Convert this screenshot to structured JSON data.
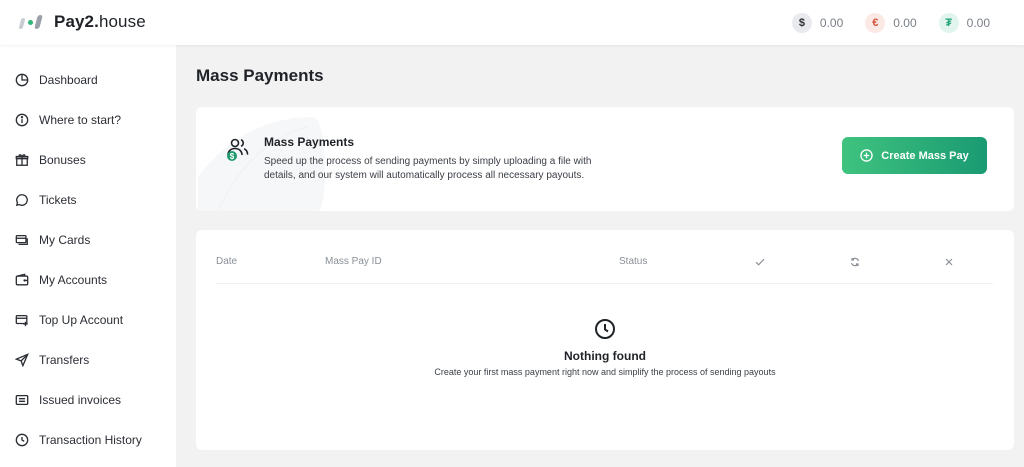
{
  "brand": {
    "name_bold": "Pay2.",
    "name_light": "house"
  },
  "balances": [
    {
      "currency_icon": "dollar-icon",
      "symbol": "$",
      "amount": "0.00"
    },
    {
      "currency_icon": "euro-icon",
      "symbol": "€",
      "amount": "0.00"
    },
    {
      "currency_icon": "tether-icon",
      "symbol": "₮",
      "amount": "0.00"
    }
  ],
  "sidebar": {
    "items": [
      {
        "label": "Dashboard",
        "icon": "pie-chart-icon"
      },
      {
        "label": "Where to start?",
        "icon": "info-icon"
      },
      {
        "label": "Bonuses",
        "icon": "gift-icon"
      },
      {
        "label": "Tickets",
        "icon": "chat-bubble-icon"
      },
      {
        "label": "My Cards",
        "icon": "cards-icon"
      },
      {
        "label": "My Accounts",
        "icon": "wallet-icon"
      },
      {
        "label": "Top Up Account",
        "icon": "top-up-icon"
      },
      {
        "label": "Transfers",
        "icon": "send-icon"
      },
      {
        "label": "Issued invoices",
        "icon": "invoice-icon"
      },
      {
        "label": "Transaction History",
        "icon": "clock-icon"
      }
    ]
  },
  "page": {
    "title": "Mass Payments"
  },
  "intro": {
    "title": "Mass Payments",
    "description": "Speed up the process of sending payments by simply uploading a file with details, and our system will automatically process all necessary payouts.",
    "create_button": "Create Mass Pay"
  },
  "table": {
    "columns": [
      "Date",
      "Mass Pay ID",
      "Status"
    ],
    "icon_columns": [
      "check-icon",
      "refresh-icon",
      "close-icon"
    ]
  },
  "empty_state": {
    "title": "Nothing found",
    "description": "Create your first mass payment right now and simplify the process of sending payouts"
  },
  "colors": {
    "accent_start": "#3fc37f",
    "accent_end": "#1a9a72",
    "background": "#f2f2f3"
  }
}
